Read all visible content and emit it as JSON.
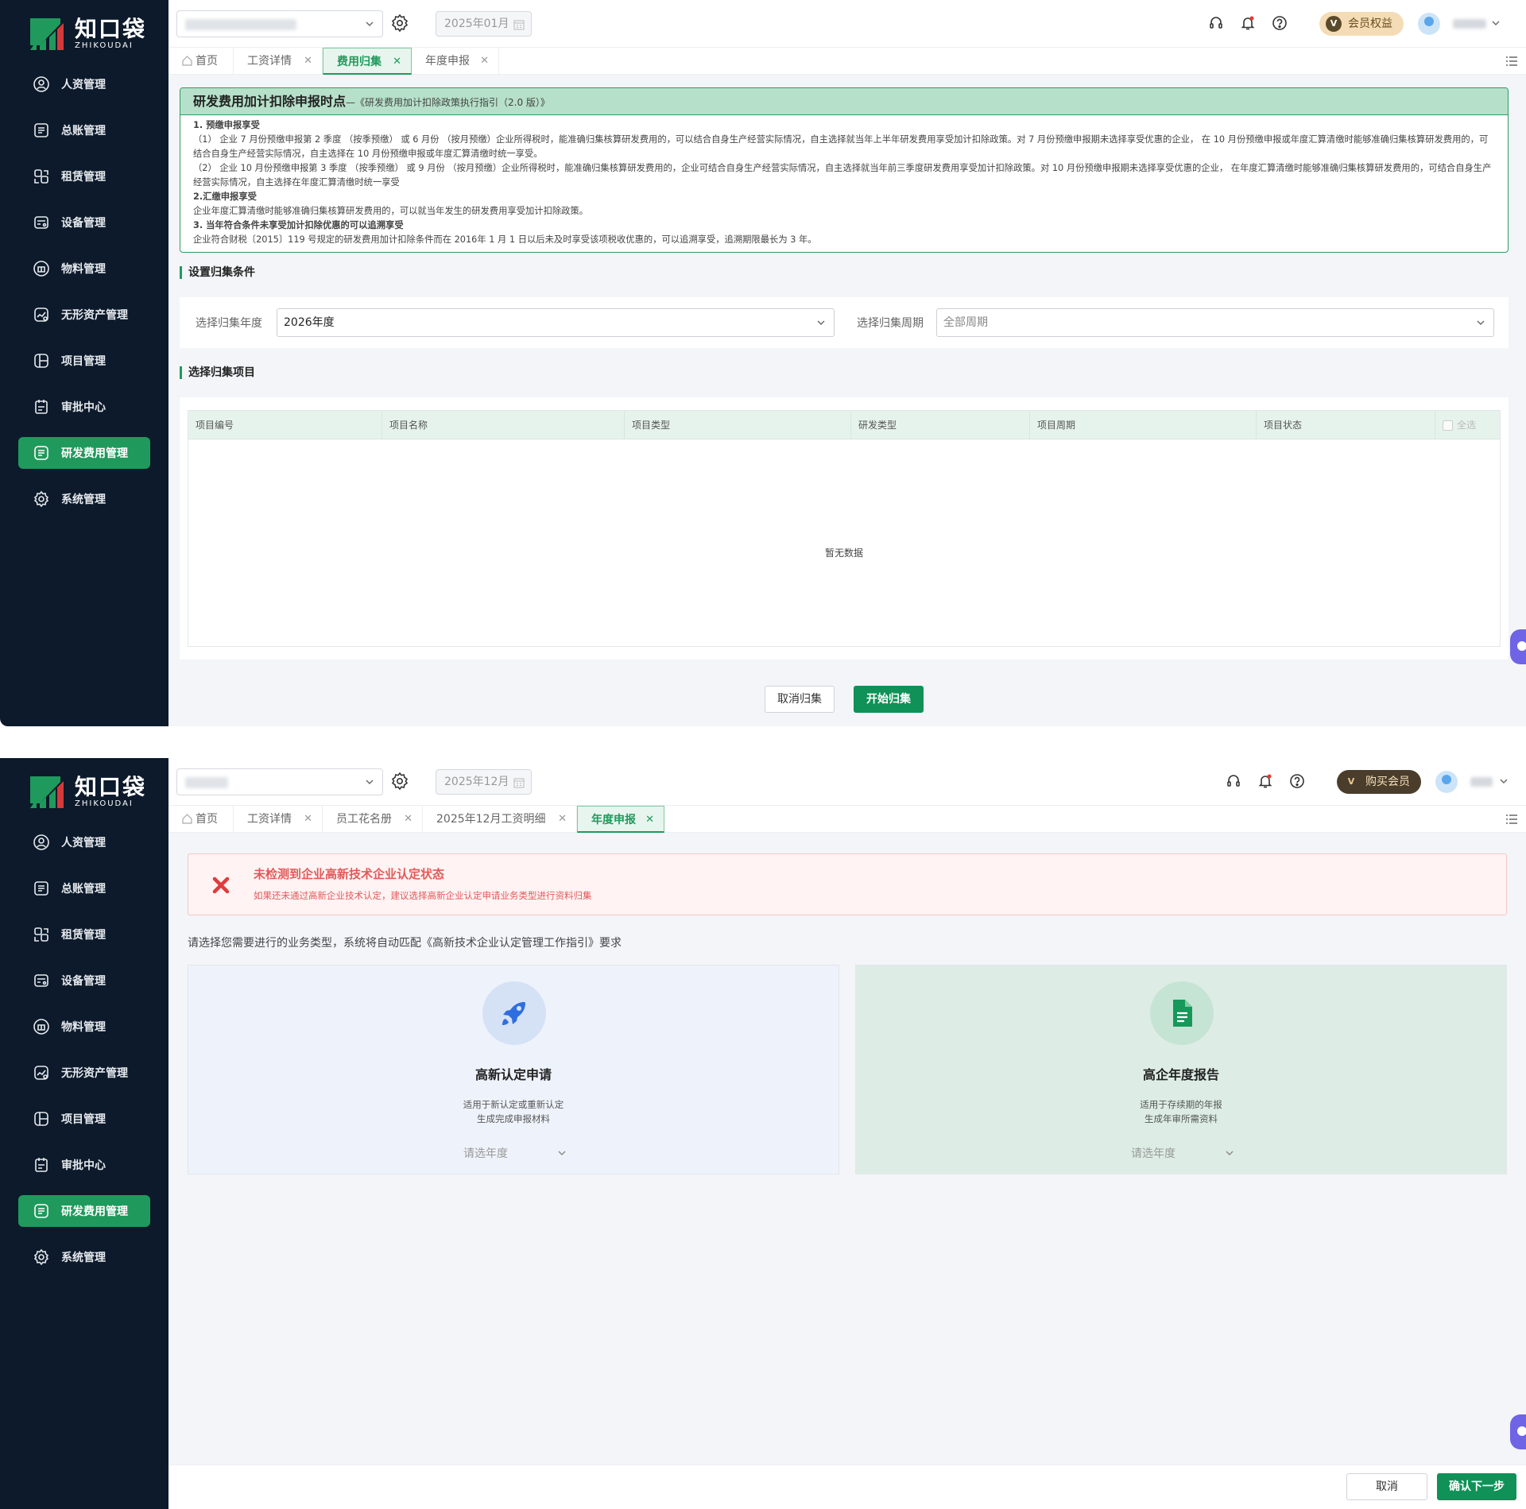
{
  "app": {
    "logo_cn": "知口袋",
    "logo_en": "ZHIKOUDAI",
    "accent_color": "#1f9a5c",
    "sidebar_bg": "#0c1a2b"
  },
  "sidebar": {
    "items": [
      {
        "label": "人资管理",
        "icon": "person-shield-icon"
      },
      {
        "label": "总账管理",
        "icon": "ledger-icon"
      },
      {
        "label": "租赁管理",
        "icon": "lease-icon"
      },
      {
        "label": "设备管理",
        "icon": "device-icon"
      },
      {
        "label": "物料管理",
        "icon": "material-icon"
      },
      {
        "label": "无形资产管理",
        "icon": "intangible-asset-icon"
      },
      {
        "label": "项目管理",
        "icon": "project-icon"
      },
      {
        "label": "审批中心",
        "icon": "approval-icon"
      },
      {
        "label": "研发费用管理",
        "icon": "rd-expense-icon",
        "active": true
      },
      {
        "label": "系统管理",
        "icon": "gear-icon"
      }
    ]
  },
  "screen1": {
    "month": "2025年01月",
    "vip_label": "会员权益",
    "vip_badge": "V",
    "tabs": [
      {
        "label": "首页",
        "closable": false,
        "active": false
      },
      {
        "label": "工资详情",
        "closable": true,
        "active": false
      },
      {
        "label": "费用归集",
        "closable": true,
        "active": true
      },
      {
        "label": "年度申报",
        "closable": true,
        "active": false
      }
    ],
    "notice": {
      "title": "研发费用加计扣除申报时点",
      "subtitle": "—《研发费用加计扣除政策执行指引（2.0 版）》",
      "lines": [
        {
          "text": "1. 预缴申报享受",
          "bold": true
        },
        {
          "text": "（1） 企业 7 月份预缴申报第 2 季度 （按季预缴） 或 6 月份 （按月预缴）企业所得税时，能准确归集核算研发费用的，可以结合自身生产经营实际情况，自主选择就当年上半年研发费用享受加计扣除政策。对 7 月份预缴申报期未选择享受优惠的企业， 在 10 月份预缴申报或年度汇算清缴时能够准确归集核算研发费用的，可结合自身生产经营实际情况，自主选择在 10 月份预缴申报或年度汇算清缴时统一享受。",
          "bold": false
        },
        {
          "text": "（2） 企业 10 月份预缴申报第 3 季度 （按季预缴） 或 9 月份 （按月预缴）企业所得税时，能准确归集核算研发费用的，企业可结合自身生产经营实际情况，自主选择就当年前三季度研发费用享受加计扣除政策。对 10 月份预缴申报期未选择享受优惠的企业， 在年度汇算清缴时能够准确归集核算研发费用的，可结合自身生产经营实际情况，自主选择在年度汇算清缴时统一享受",
          "bold": false
        },
        {
          "text": "2.汇缴申报享受",
          "bold": true
        },
        {
          "text": "企业年度汇算清缴时能够准确归集核算研发费用的，可以就当年发生的研发费用享受加计扣除政策。",
          "bold": false
        },
        {
          "text": "3. 当年符合条件未享受加计扣除优惠的可以追溯享受",
          "bold": true
        },
        {
          "text": "企业符合财税〔2015〕119 号规定的研发费用加计扣除条件而在 2016年 1 月 1 日以后未及时享受该项税收优惠的，可以追溯享受，追溯期限最长为 3 年。",
          "bold": false
        }
      ]
    },
    "conditions": {
      "section_title": "设置归集条件",
      "year_label": "选择归集年度",
      "year_value": "2026年度",
      "period_label": "选择归集周期",
      "period_value": "全部周期"
    },
    "projects": {
      "section_title": "选择归集项目",
      "columns": [
        "项目编号",
        "项目名称",
        "项目类型",
        "研发类型",
        "项目周期",
        "项目状态"
      ],
      "select_all": "全选",
      "empty_text": "暂无数据"
    },
    "buttons": {
      "cancel": "取消归集",
      "start": "开始归集"
    }
  },
  "screen2": {
    "month": "2025年12月",
    "vip_label": "购买会员",
    "vip_badge": "V",
    "tabs": [
      {
        "label": "首页",
        "closable": false,
        "active": false
      },
      {
        "label": "工资详情",
        "closable": true,
        "active": false
      },
      {
        "label": "员工花名册",
        "closable": true,
        "active": false
      },
      {
        "label": "2025年12月工资明细",
        "closable": true,
        "active": false
      },
      {
        "label": "年度申报",
        "closable": true,
        "active": true
      }
    ],
    "alert": {
      "title": "未检测到企业高新技术企业认定状态",
      "desc": "如果还未通过高新企业技术认定，建议选择高新企业认定申请业务类型进行资料归集",
      "color": "#e25a5a"
    },
    "instruction": "请选择您需要进行的业务类型，系统将自动匹配《高新技术企业认定管理工作指引》要求",
    "cards": [
      {
        "title": "高新认定申请",
        "desc1": "适用于新认定或重新认定",
        "desc2": "生成完成申报材料",
        "select": "请选年度",
        "icon": "rocket-icon"
      },
      {
        "title": "高企年度报告",
        "desc1": "适用于存续期的年报",
        "desc2": "生成年审所需资料",
        "select": "请选年度",
        "icon": "document-icon"
      }
    ],
    "buttons": {
      "cancel": "取消",
      "next": "确认下一步"
    }
  }
}
